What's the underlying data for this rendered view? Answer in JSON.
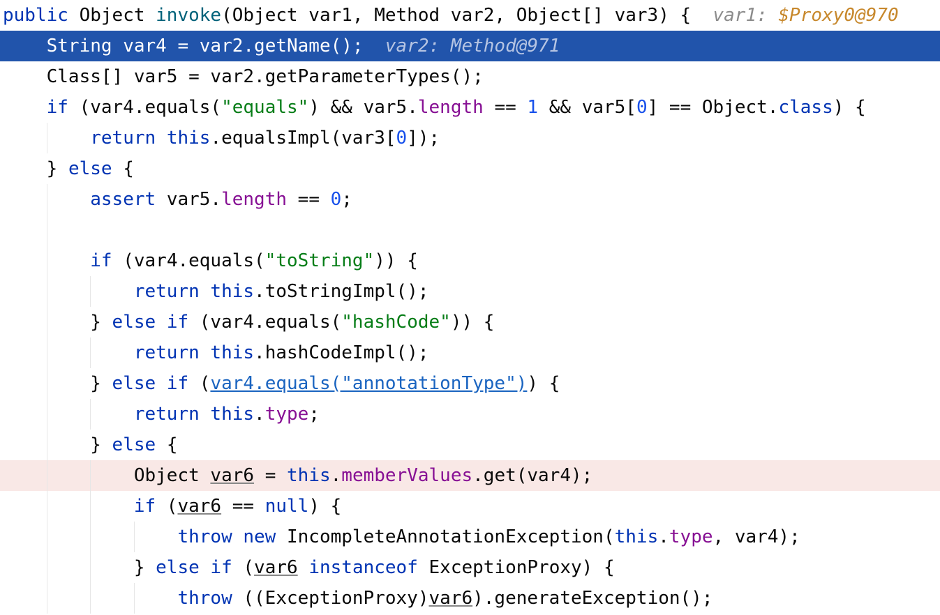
{
  "lines": [
    {
      "indent": 0,
      "hl": "",
      "tokens": [
        {
          "t": "public ",
          "c": "kw"
        },
        {
          "t": "Object ",
          "c": "plain"
        },
        {
          "t": "invoke",
          "c": "fn"
        },
        {
          "t": "(Object var1, Method var2, Object[] var3) {  ",
          "c": "plain"
        },
        {
          "t": "var1: ",
          "c": "hint"
        },
        {
          "t": "$Proxy0@970",
          "c": "hintval"
        }
      ]
    },
    {
      "indent": 1,
      "hl": "exec",
      "tokens": [
        {
          "t": "String var4 = var2.getName();  ",
          "c": "plain"
        },
        {
          "t": "var2: Method@971",
          "c": "hint"
        }
      ]
    },
    {
      "indent": 1,
      "hl": "",
      "tokens": [
        {
          "t": "Class[] var5 = var2.getParameterTypes();",
          "c": "plain"
        }
      ]
    },
    {
      "indent": 1,
      "hl": "",
      "tokens": [
        {
          "t": "if",
          "c": "kw"
        },
        {
          "t": " (var4.equals(",
          "c": "plain"
        },
        {
          "t": "\"equals\"",
          "c": "str"
        },
        {
          "t": ") && var5.",
          "c": "plain"
        },
        {
          "t": "length",
          "c": "field"
        },
        {
          "t": " == ",
          "c": "plain"
        },
        {
          "t": "1",
          "c": "num"
        },
        {
          "t": " && var5[",
          "c": "plain"
        },
        {
          "t": "0",
          "c": "num"
        },
        {
          "t": "] == Object.",
          "c": "plain"
        },
        {
          "t": "class",
          "c": "kw"
        },
        {
          "t": ") {",
          "c": "plain"
        }
      ]
    },
    {
      "indent": 2,
      "hl": "",
      "tokens": [
        {
          "t": "return ",
          "c": "kw"
        },
        {
          "t": "this",
          "c": "kw"
        },
        {
          "t": ".equalsImpl(var3[",
          "c": "plain"
        },
        {
          "t": "0",
          "c": "num"
        },
        {
          "t": "]);",
          "c": "plain"
        }
      ]
    },
    {
      "indent": 1,
      "hl": "",
      "tokens": [
        {
          "t": "} ",
          "c": "plain"
        },
        {
          "t": "else",
          "c": "kw"
        },
        {
          "t": " {",
          "c": "plain"
        }
      ]
    },
    {
      "indent": 2,
      "hl": "",
      "tokens": [
        {
          "t": "assert ",
          "c": "kw"
        },
        {
          "t": "var5.",
          "c": "plain"
        },
        {
          "t": "length",
          "c": "field"
        },
        {
          "t": " == ",
          "c": "plain"
        },
        {
          "t": "0",
          "c": "num"
        },
        {
          "t": ";",
          "c": "plain"
        }
      ]
    },
    {
      "indent": 0,
      "hl": "",
      "tokens": []
    },
    {
      "indent": 2,
      "hl": "",
      "tokens": [
        {
          "t": "if",
          "c": "kw"
        },
        {
          "t": " (var4.equals(",
          "c": "plain"
        },
        {
          "t": "\"toString\"",
          "c": "str"
        },
        {
          "t": ")) {",
          "c": "plain"
        }
      ]
    },
    {
      "indent": 3,
      "hl": "",
      "tokens": [
        {
          "t": "return ",
          "c": "kw"
        },
        {
          "t": "this",
          "c": "kw"
        },
        {
          "t": ".toStringImpl();",
          "c": "plain"
        }
      ]
    },
    {
      "indent": 2,
      "hl": "",
      "tokens": [
        {
          "t": "} ",
          "c": "plain"
        },
        {
          "t": "else if",
          "c": "kw"
        },
        {
          "t": " (var4.equals(",
          "c": "plain"
        },
        {
          "t": "\"hashCode\"",
          "c": "str"
        },
        {
          "t": ")) {",
          "c": "plain"
        }
      ]
    },
    {
      "indent": 3,
      "hl": "",
      "tokens": [
        {
          "t": "return ",
          "c": "kw"
        },
        {
          "t": "this",
          "c": "kw"
        },
        {
          "t": ".hashCodeImpl();",
          "c": "plain"
        }
      ]
    },
    {
      "indent": 2,
      "hl": "",
      "tokens": [
        {
          "t": "} ",
          "c": "plain"
        },
        {
          "t": "else if",
          "c": "kw"
        },
        {
          "t": " (",
          "c": "plain"
        },
        {
          "t": "var4.equals(\"annotationType\")",
          "c": "link"
        },
        {
          "t": ") {",
          "c": "plain"
        }
      ]
    },
    {
      "indent": 3,
      "hl": "",
      "tokens": [
        {
          "t": "return ",
          "c": "kw"
        },
        {
          "t": "this",
          "c": "kw"
        },
        {
          "t": ".",
          "c": "plain"
        },
        {
          "t": "type",
          "c": "field"
        },
        {
          "t": ";",
          "c": "plain"
        }
      ]
    },
    {
      "indent": 2,
      "hl": "",
      "tokens": [
        {
          "t": "} ",
          "c": "plain"
        },
        {
          "t": "else",
          "c": "kw"
        },
        {
          "t": " {",
          "c": "plain"
        }
      ]
    },
    {
      "indent": 3,
      "hl": "bp",
      "tokens": [
        {
          "t": "Object ",
          "c": "plain"
        },
        {
          "t": "var6",
          "c": "var"
        },
        {
          "t": " = ",
          "c": "plain"
        },
        {
          "t": "this",
          "c": "kw"
        },
        {
          "t": ".",
          "c": "plain"
        },
        {
          "t": "memberValues",
          "c": "field"
        },
        {
          "t": ".get(var4);",
          "c": "plain"
        }
      ]
    },
    {
      "indent": 3,
      "hl": "",
      "tokens": [
        {
          "t": "if",
          "c": "kw"
        },
        {
          "t": " (",
          "c": "plain"
        },
        {
          "t": "var6",
          "c": "var"
        },
        {
          "t": " == ",
          "c": "plain"
        },
        {
          "t": "null",
          "c": "kw"
        },
        {
          "t": ") {",
          "c": "plain"
        }
      ]
    },
    {
      "indent": 4,
      "hl": "",
      "tokens": [
        {
          "t": "throw ",
          "c": "kw"
        },
        {
          "t": "new ",
          "c": "kw"
        },
        {
          "t": "IncompleteAnnotationException(",
          "c": "plain"
        },
        {
          "t": "this",
          "c": "kw"
        },
        {
          "t": ".",
          "c": "plain"
        },
        {
          "t": "type",
          "c": "field"
        },
        {
          "t": ", var4);",
          "c": "plain"
        }
      ]
    },
    {
      "indent": 3,
      "hl": "",
      "tokens": [
        {
          "t": "} ",
          "c": "plain"
        },
        {
          "t": "else if",
          "c": "kw"
        },
        {
          "t": " (",
          "c": "plain"
        },
        {
          "t": "var6",
          "c": "var"
        },
        {
          "t": " ",
          "c": "plain"
        },
        {
          "t": "instanceof",
          "c": "kw"
        },
        {
          "t": " ExceptionProxy) {",
          "c": "plain"
        }
      ]
    },
    {
      "indent": 4,
      "hl": "",
      "tokens": [
        {
          "t": "throw ",
          "c": "kw"
        },
        {
          "t": "((ExceptionProxy)",
          "c": "plain"
        },
        {
          "t": "var6",
          "c": "var"
        },
        {
          "t": ").generateException();",
          "c": "plain"
        }
      ]
    }
  ]
}
